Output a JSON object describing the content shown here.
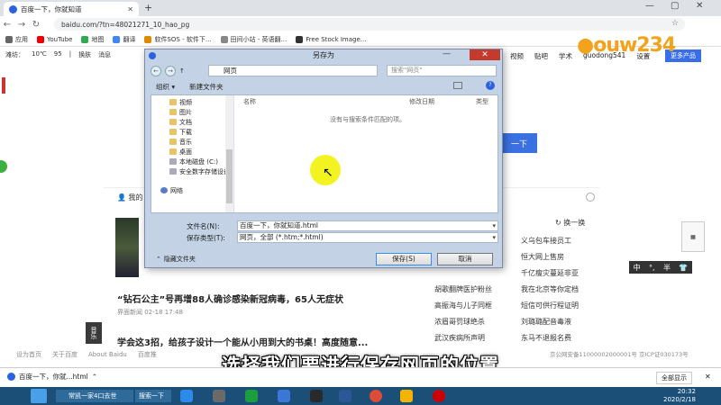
{
  "browser": {
    "tab_title": "百度一下，你就知道",
    "url": "baidu.com/?tn=48021271_10_hao_pg",
    "bookmarks": [
      "应用",
      "YouTube",
      "地图",
      "翻译",
      "软件SOS - 软件下...",
      "田间小站 - 英语翻...",
      "Free Stock Image..."
    ]
  },
  "page": {
    "weather": [
      "滩坊：",
      "10℃",
      "95",
      "|",
      "换肤",
      "消息"
    ],
    "top_nav": [
      "视频",
      "贴吧",
      "学术",
      "guodong541",
      "设置"
    ],
    "more_products": "更多产品",
    "search_button": "一下",
    "mine": "我的",
    "refresh": "换一换",
    "hot_right": [
      "义乌包车接员工",
      "恒大网上售房",
      "千亿瘦灾蔓延非亚",
      "我在北京等你定档",
      "短信可供行程证明",
      "刘璐璐配音毒液",
      "东马不退报名费"
    ],
    "hot_left": [
      "胡歌翻牌医护粉丝",
      "高振海与儿子同框",
      "浓眉哥罚球绝杀",
      "武汉疾病所声明"
    ],
    "news1_title": "“钻石公主”号再增88人确诊感染新冠病毒，65人无症状",
    "news1_meta": "界面新闻  02-18 17:48",
    "news2_title": "学会这3招，给孩子设计一个能从小用到大的书桌！高度随意...",
    "music_label": "音乐",
    "footer": [
      "设为首页",
      "关于百度",
      "About Baidu",
      "百度推"
    ],
    "footer_right": "京公网安备11000002000001号  京ICP证030173号",
    "ime": [
      "中",
      "°,",
      "半"
    ],
    "logo": "ouw234"
  },
  "dialog": {
    "title": "另存为",
    "path": "网页",
    "search_placeholder": "搜索\"网页\"",
    "organize": "组织 ▾",
    "new_folder": "新建文件夹",
    "tree": [
      "视频",
      "图片",
      "文档",
      "下载",
      "音乐",
      "桌面",
      "本地磁盘 (C:)",
      "安全数字存储设备"
    ],
    "network": "网络",
    "columns": [
      "名称",
      "修改日期",
      "类型"
    ],
    "empty_message": "没有与搜索条件匹配的项。",
    "filename_label": "文件名(N):",
    "filename_value": "百度一下，你就知道.html",
    "type_label": "保存类型(T):",
    "type_value": "网页，全部 (*.htm;*.html)",
    "hide_folders": "隐藏文件夹",
    "save_button": "保存(S)",
    "cancel_button": "取消"
  },
  "subtitle": "选择我们要进行保存网页的位置",
  "downloads": {
    "item": "百度一下，你就...html",
    "show_all": "全部显示"
  },
  "taskbar": {
    "task1": "常凯一家4口去世",
    "task2": "搜索一下",
    "time": "20:32",
    "date": "2020/2/18"
  }
}
